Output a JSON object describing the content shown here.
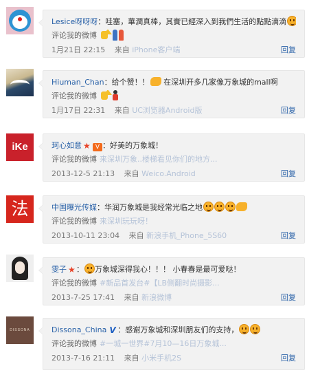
{
  "labels": {
    "commented": "评论我的微博",
    "from": "来自",
    "reply": "回复"
  },
  "comments": [
    {
      "user": "Lesice呀呀呀",
      "text": "：哇塞，華潤真棒，其實已經深入到我們生活的點點滴滴",
      "weibo": "",
      "time": "1月21日 22:15",
      "source": "iPhone客户端"
    },
    {
      "user": "Hiuman_Chan",
      "text": "：给个赞！！",
      "text2": "在深圳开多几家像万象城的mall啊",
      "weibo": "",
      "time": "1月17日 22:31",
      "source": "UC浏览器Android版"
    },
    {
      "user": "珂心如意",
      "text": "：好美的万象城！",
      "weibo": "来深圳万象..楼梯看见你们的地方...",
      "time": "2013-12-5 21:13",
      "source": "Weico.Android"
    },
    {
      "user": "中国曝光传媒",
      "text": "：华润万象城是我经常光临之地",
      "weibo": "来深圳玩玩呀！",
      "time": "2013-10-11 23:04",
      "source": "新浪手机_Phone_5S60"
    },
    {
      "user": "雯子",
      "text": "万象城深得我心！！！ 小春春是最可爱哒！",
      "weibo": "#新品首发台#【LB侧翻时尚摄影...",
      "time": "2013-7-25 17:41",
      "source": "新浪微博"
    },
    {
      "user": "Dissona_China",
      "text": "：感谢万象城和深圳朋友们的支持，",
      "weibo": "#一城一世界#7月10—16日万象城...",
      "time": "2013-7-16 21:11",
      "source": "小米手机2S"
    }
  ],
  "avatars": {
    "ike": "iKe",
    "fa": "法",
    "dissona": "DISSONA"
  }
}
